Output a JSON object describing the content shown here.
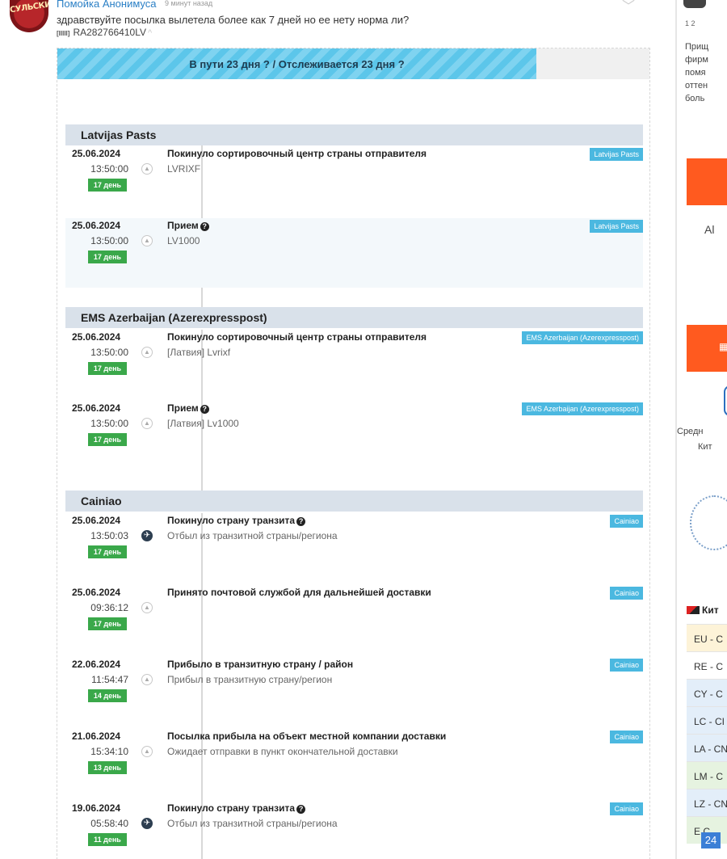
{
  "comment": {
    "avatar_text": "СУЛЬСКИ",
    "author": "Помойка Анонимуса",
    "time": "9 минут назад",
    "question": "здравствуйте посылка вылетела более как 7 дней но ее нету норма ли?",
    "track_code": "RA282766410LV",
    "barcode_icon": "[IIIII]"
  },
  "banner": {
    "text": "В пути 23 дня ? / Отслеживается 23 дня ?"
  },
  "groups": [
    {
      "name": "Latvijas Pasts",
      "events": [
        {
          "date": "25.06.2024",
          "time": "13:50:00",
          "day": "17 день",
          "title": "Покинуло сортировочный центр страны отправителя",
          "sub": "LVRIXF",
          "tag": "Latvijas Pasts"
        },
        {
          "date": "25.06.2024",
          "time": "13:50:00",
          "day": "17 день",
          "title": "Прием",
          "sub": "LV1000",
          "tag": "Latvijas Pasts"
        }
      ]
    },
    {
      "name": "EMS Azerbaijan (Azerexpresspost)",
      "events": [
        {
          "date": "25.06.2024",
          "time": "13:50:00",
          "day": "17 день",
          "title": "Покинуло сортировочный центр страны отправителя",
          "sub": "[Латвия] Lvrixf",
          "tag": "EMS Azerbaijan (Azerexpresspost)"
        },
        {
          "date": "25.06.2024",
          "time": "13:50:00",
          "day": "17 день",
          "title": "Прием",
          "sub": "[Латвия] Lv1000",
          "tag": "EMS Azerbaijan (Azerexpresspost)"
        }
      ]
    },
    {
      "name": "Cainiao",
      "events": [
        {
          "date": "25.06.2024",
          "time": "13:50:03",
          "day": "17 день",
          "title": "Покинуло страну транзита",
          "sub": "Отбыл из транзитной страны/региона",
          "tag": "Cainiao"
        },
        {
          "date": "25.06.2024",
          "time": "09:36:12",
          "day": "17 день",
          "title": "Принято почтовой службой для дальнейшей доставки",
          "sub": "",
          "tag": "Cainiao"
        },
        {
          "date": "22.06.2024",
          "time": "11:54:47",
          "day": "14 день",
          "title": "Прибыло в транзитную страну / район",
          "sub": "Прибыл в транзитную страну/регион",
          "tag": "Cainiao"
        },
        {
          "date": "21.06.2024",
          "time": "15:34:10",
          "day": "13 день",
          "title": "Посылка прибыла на объект местной компании доставки",
          "sub": "Ожидает отправки в пункт окончательной доставки",
          "tag": "Cainiao"
        },
        {
          "date": "19.06.2024",
          "time": "05:58:40",
          "day": "11 день",
          "title": "Покинуло страну транзита",
          "sub": "Отбыл из транзитной страны/региона",
          "tag": "Cainiao"
        }
      ]
    }
  ],
  "sidebar": {
    "page_nums": "1 2",
    "desc": [
      "Прищ",
      "фирм",
      "помя",
      "оттен",
      "боль"
    ],
    "al_text": "Al",
    "sred": "Средн",
    "kit": "Кит",
    "table_title": "Кит",
    "rows": [
      "EU - C",
      "RE - C",
      "CY - C",
      "LC - CI",
      "LA - CN",
      "LM - C",
      "LZ - CN",
      "E  C"
    ],
    "badge": "24",
    "colors": {
      "orange": "#ff5a1f",
      "tag_blue": "#4bb8e0",
      "day_green": "#3aa84a"
    }
  }
}
